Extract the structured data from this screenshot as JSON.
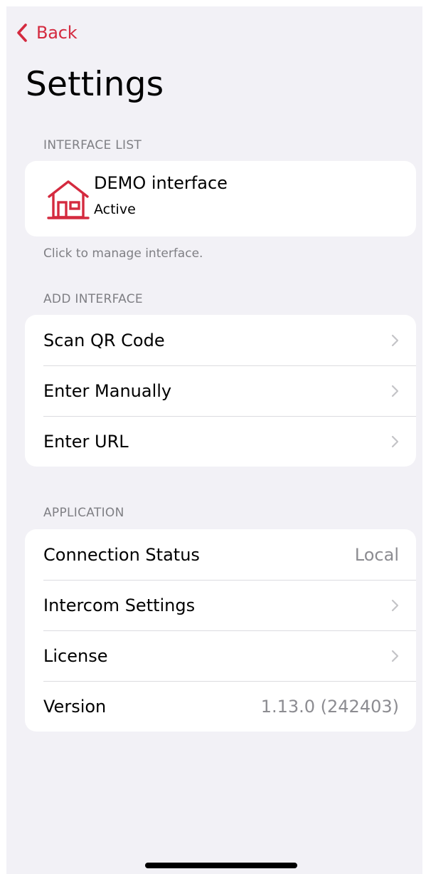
{
  "nav": {
    "back_label": "Back",
    "title": "Settings"
  },
  "interface_list": {
    "header": "INTERFACE LIST",
    "item": {
      "icon": "house-icon",
      "name": "DEMO interface",
      "status": "Active"
    },
    "footer": "Click to manage interface."
  },
  "add_interface": {
    "header": "ADD INTERFACE",
    "rows": [
      {
        "label": "Scan QR Code"
      },
      {
        "label": "Enter Manually"
      },
      {
        "label": "Enter URL"
      }
    ]
  },
  "application": {
    "header": "APPLICATION",
    "rows": [
      {
        "label": "Connection Status",
        "value": "Local"
      },
      {
        "label": "Intercom Settings"
      },
      {
        "label": "License"
      },
      {
        "label": "Version",
        "value": "1.13.0 (242403)"
      }
    ]
  },
  "colors": {
    "accent": "#d42a3f",
    "background": "#f2f1f6",
    "card": "#ffffff",
    "secondary_text": "#8c8c91"
  }
}
